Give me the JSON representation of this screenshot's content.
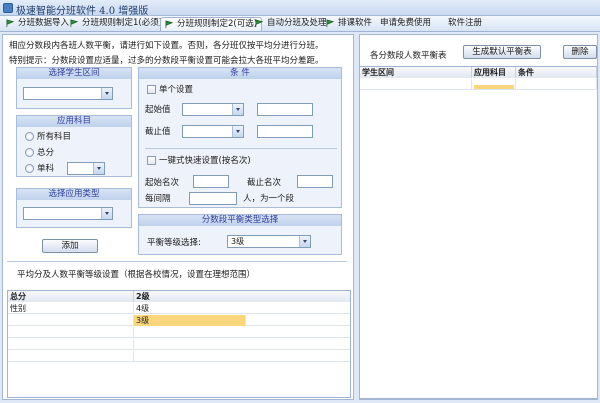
{
  "window": {
    "title": "极速智能分班软件 4.0 增强版"
  },
  "tabs": [
    {
      "label": "分班数据导入",
      "flag_color": "#2e8b3a"
    },
    {
      "label": "分班规则制定1(必须)",
      "flag_color": "#2e8b3a"
    },
    {
      "label": "分班规则制定2(可选)",
      "flag_color": "#2e8b3a"
    },
    {
      "label": "自动分班及处理",
      "flag_color": "#2e8b3a"
    },
    {
      "label": "排课软件",
      "flag_color": "#2e8b3a"
    },
    {
      "label": "申请免费使用"
    },
    {
      "label": "软件注册"
    }
  ],
  "left": {
    "hint1": "相应分数段内各班人数平衡，请进行如下设置。否则，各分班仅按平均分进行分班。",
    "hint2": "特别提示：分数段设置应适量，过多的分数段平衡设置可能会拉大各班平均分差距。",
    "student_range": {
      "title": "选择学生区间",
      "value": ""
    },
    "subject": {
      "title": "应用科目",
      "options": [
        "所有科目",
        "总分",
        "单科"
      ],
      "single_value": ""
    },
    "apply_type": {
      "title": "选择应用类型",
      "value": ""
    },
    "add_button": "添加",
    "condition": {
      "title": "条  件",
      "single_setting": "单个设置",
      "start_label": "起始值",
      "end_label": "截止值",
      "quick_setting": "一键式快速设置(按名次)",
      "start_rank_label": "起始名次",
      "end_rank_label": "截止名次",
      "interval_label": "每间隔",
      "interval_suffix": "人，为一个段"
    },
    "balance": {
      "title": "分数段平衡类型选择",
      "level_label": "平衡等级选择:",
      "level_value": "3级"
    },
    "avg_note": "平均分及人数平衡等级设置（根据各校情况，设置在理想范围）",
    "grid": {
      "columns": [
        "总分",
        "2级"
      ],
      "rows": [
        [
          "性别",
          "4级"
        ],
        [
          "",
          "3级"
        ],
        [
          "",
          ""
        ],
        [
          "",
          ""
        ],
        [
          "",
          ""
        ]
      ]
    }
  },
  "right": {
    "label": "各分数段人数平衡表",
    "default_button": "生成默认平衡表",
    "delete_button": "删除",
    "grid": {
      "columns": [
        "学生区间",
        "应用科目",
        "条件"
      ]
    }
  }
}
